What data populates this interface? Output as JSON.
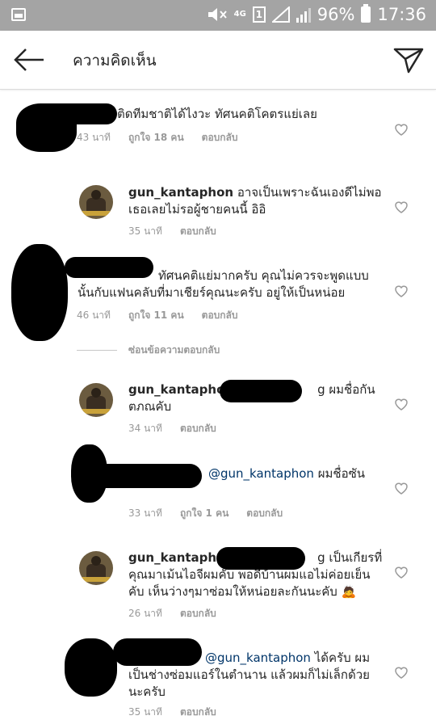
{
  "status_bar": {
    "network": "4G",
    "sim_slot": "1",
    "battery": "96%",
    "time": "17:36"
  },
  "header": {
    "title": "ความคิดเห็น"
  },
  "comments": [
    {
      "text": "ติดทีมชาติได้ไงวะ ทัศนคติโคตรแย่เลย",
      "time": "43 นาที",
      "likes": "ถูกใจ 18 คน",
      "reply": "ตอบกลับ"
    },
    {
      "username": "gun_kantaphon",
      "text_line1": "อาจเป็นเพราะฉันเองดีไม่พอ",
      "text_line2": "เธอเลยไม่รอผู้ชายคนนี้ อิอิ",
      "time": "35 นาที",
      "reply": "ตอบกลับ"
    },
    {
      "text_line1": "ทัศนคติแย่มากครับ คุณไม่ควรจะพูดแบบ",
      "text_line2": "นั้นกับแฟนคลับที่มาเชียร์คุณนะครับ อยู่ให้เป็นหน่อย",
      "time": "46 นาที",
      "likes": "ถูกใจ 11 คน",
      "reply": "ตอบกลับ"
    },
    {
      "username": "gun_kantaphon",
      "text_line1_end": "g ผมชื่อกัน",
      "text_line2": "ตภณคับ",
      "time": "34 นาที",
      "reply": "ตอบกลับ"
    },
    {
      "mention": "@gun_kantaphon",
      "text": "ผมชื่อซัน",
      "time": "33 นาที",
      "likes": "ถูกใจ 1 คน",
      "reply": "ตอบกลับ"
    },
    {
      "username": "gun_kantaphon",
      "text_line1_end": "g เป็นเกียรที่",
      "text_line2": "คุณมาเม้นไอจีผมคับ พอดีบ้านผมแอไม่ค่อยเย็น",
      "text_line3": "คับ เห็นว่างๆมาซ่อมให้หน่อยละกันนะคับ 🙇",
      "time": "26 นาที",
      "reply": "ตอบกลับ"
    },
    {
      "mention": "@gun_kantaphon",
      "text_line1": "ได้ครับ ผม",
      "text_line2": "เป็นช่างซ่อมแอร์ในตำนาน แล้วผมก็ไม่เล็กด้วย",
      "text_line3": "นะครับ",
      "time": "35 นาที",
      "reply": "ตอบกลับ"
    }
  ],
  "hidden_replies_label": "ซ่อนข้อความตอบกลับ",
  "colors": {
    "status_bar": "#a4a4a4",
    "text": "#262626",
    "meta": "#999999",
    "mention": "#003569"
  }
}
